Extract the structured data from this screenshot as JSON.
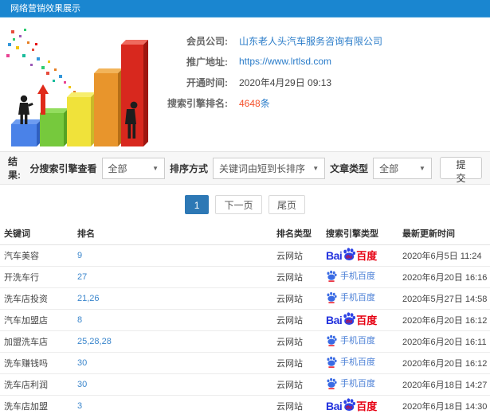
{
  "header": {
    "title": "网络营销效果展示"
  },
  "info": {
    "company_label": "会员公司:",
    "company_value": "山东老人头汽车服务咨询有限公司",
    "url_label": "推广地址:",
    "url_value": "https://www.lrtlsd.com",
    "open_time_label": "开通时间:",
    "open_time_value": "2020年4月29日 09:13",
    "rank_label": "搜索引擎排名:",
    "rank_count": "4648",
    "rank_unit": "条"
  },
  "filters": {
    "result_label": "结果:",
    "engine_filter_label": "分搜索引擎查看",
    "engine_filter_value": "全部",
    "sort_label": "排序方式",
    "sort_value": "关键词由短到长排序",
    "article_type_label": "文章类型",
    "article_type_value": "全部",
    "submit_label": "提交"
  },
  "pagination": {
    "current": "1",
    "next_label": "下一页",
    "last_label": "尾页"
  },
  "table": {
    "headers": [
      "关键词",
      "排名",
      "排名类型",
      "搜索引擎类型",
      "最新更新时间"
    ],
    "engine_labels": {
      "baidu_text": "Bai",
      "baidu_cn": "百度",
      "shouji": "手机百度"
    },
    "rows": [
      {
        "keyword": "汽车美容",
        "rank": "9",
        "rank_type": "云网站",
        "engine": "baidu",
        "updated": "2020年6月5日 11:24"
      },
      {
        "keyword": "开洗车行",
        "rank": "27",
        "rank_type": "云网站",
        "engine": "shouji",
        "updated": "2020年6月20日 16:16"
      },
      {
        "keyword": "洗车店投资",
        "rank": "21,26",
        "rank_type": "云网站",
        "engine": "shouji",
        "updated": "2020年5月27日 14:58"
      },
      {
        "keyword": "汽车加盟店",
        "rank": "8",
        "rank_type": "云网站",
        "engine": "baidu",
        "updated": "2020年6月20日 16:12"
      },
      {
        "keyword": "加盟洗车店",
        "rank": "25,28,28",
        "rank_type": "云网站",
        "engine": "shouji",
        "updated": "2020年6月20日 16:11"
      },
      {
        "keyword": "洗车赚钱吗",
        "rank": "30",
        "rank_type": "云网站",
        "engine": "shouji",
        "updated": "2020年6月20日 16:12"
      },
      {
        "keyword": "洗车店利润",
        "rank": "30",
        "rank_type": "云网站",
        "engine": "shouji",
        "updated": "2020年6月18日 14:27"
      },
      {
        "keyword": "洗车店加盟",
        "rank": "3",
        "rank_type": "云网站",
        "engine": "baidu",
        "updated": "2020年6月18日 14:30"
      }
    ]
  },
  "colors": {
    "header_blue": "#1a86d0",
    "link_blue": "#2a7cc9",
    "highlight_orange": "#f4502a",
    "pagination_active_blue": "#2d78b5",
    "baidu_blue": "#2433de",
    "baidu_red": "#e60012",
    "mobile_baidu_blue": "#4a7fd6"
  }
}
